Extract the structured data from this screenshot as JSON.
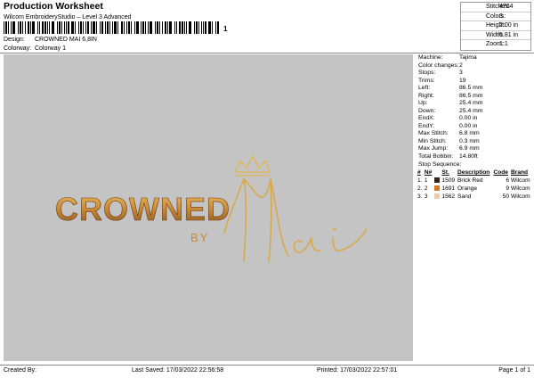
{
  "header": {
    "title": "Production Worksheet",
    "subtitle": "Wilcom EmbroideryStudio – Level 3 Advanced",
    "barcode_suffix": "1",
    "design_label": "Design:",
    "design_value": "CROWNED MAI 6,8IN",
    "colorway_label": "Colorway:",
    "colorway_value": "Colorway 1"
  },
  "top_stats": [
    {
      "label": "Stitches:",
      "value": "4764"
    },
    {
      "label": "Colors:",
      "value": "3"
    },
    {
      "label": "Height:",
      "value": "2.00 in"
    },
    {
      "label": "Width:",
      "value": "6.81 in"
    },
    {
      "label": "Zoom:",
      "value": "1:1"
    }
  ],
  "design": {
    "word_main": "CROWNED",
    "word_by": "BY",
    "word_script": "Mai",
    "colors": {
      "gold": "#d8a94a",
      "brick": "#8a5526",
      "orange": "#c98933",
      "canvas": "#c4c4c4"
    }
  },
  "machine_info": [
    {
      "label": "Machine:",
      "value": "Tajima"
    },
    {
      "label": "Color changes:",
      "value": "2"
    },
    {
      "label": "Stops:",
      "value": "3"
    },
    {
      "label": "Trims:",
      "value": "19"
    },
    {
      "label": "Left:",
      "value": "86.5 mm"
    },
    {
      "label": "Right:",
      "value": "86.5 mm"
    },
    {
      "label": "Up:",
      "value": "25.4 mm"
    },
    {
      "label": "Down:",
      "value": "25.4 mm"
    },
    {
      "label": "EndX:",
      "value": "0.00 in"
    },
    {
      "label": "EndY:",
      "value": "0.00 in"
    },
    {
      "label": "Max Stitch:",
      "value": "6.8 mm"
    },
    {
      "label": "Min Stitch:",
      "value": "0.3 mm"
    },
    {
      "label": "Max Jump:",
      "value": "6.9 mm"
    },
    {
      "label": "Total Bobbin:",
      "value": "14.80ft"
    }
  ],
  "stop_sequence": {
    "title": "Stop Sequence:",
    "headers": [
      "#",
      "N#",
      "St.",
      "Description",
      "Code",
      "Brand"
    ],
    "rows": [
      {
        "idx": "1.",
        "n": "1",
        "color": "#3b2314",
        "st": "1509",
        "desc": "Brick Red",
        "code": "6",
        "brand": "Wilcom"
      },
      {
        "idx": "2.",
        "n": "2",
        "color": "#d2792c",
        "st": "1691",
        "desc": "Orange",
        "code": "9",
        "brand": "Wilcom"
      },
      {
        "idx": "3.",
        "n": "3",
        "color": "#f2c9a6",
        "st": "1562",
        "desc": "Sand",
        "code": "50",
        "brand": "Wilcom"
      }
    ]
  },
  "footer": {
    "created_by": "Created By:",
    "last_saved": "Last Saved: 17/03/2022 22:56:58",
    "printed": "Printed: 17/03/2022 22:57:01",
    "page": "Page 1 of 1"
  }
}
